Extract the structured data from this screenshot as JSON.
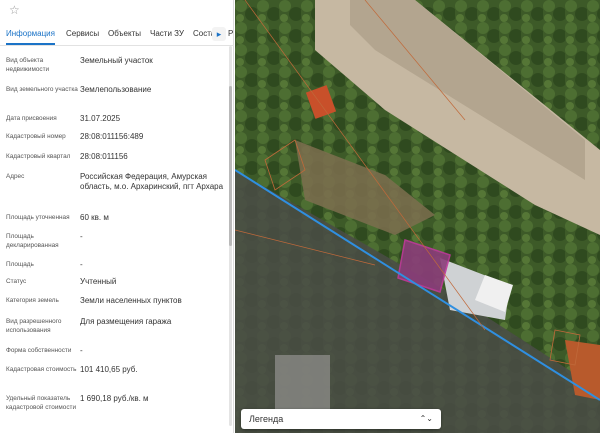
{
  "panel": {
    "star_icon": "star-icon",
    "tabs": [
      "Информация",
      "Сервисы",
      "Объекты",
      "Части ЗУ",
      "Соста"
    ],
    "tab_more": "Р",
    "rows": [
      {
        "label": "Вид объекта недвижимости",
        "value": "Земельный участок"
      },
      {
        "label": "Вид земельного участка",
        "value": "Землепользование"
      },
      {
        "label": "Дата присвоения",
        "value": "31.07.2025"
      },
      {
        "label": "Кадастровый номер",
        "value": "28:08:011156:489"
      },
      {
        "label": "Кадастровый квартал",
        "value": "28:08:011156"
      },
      {
        "label": "Адрес",
        "value": "Российская Федерация, Амурская область, м.о. Архаринский, пгт Архара"
      },
      {
        "label": "Площадь уточненная",
        "value": "60 кв. м"
      },
      {
        "label": "Площадь декларированная",
        "value": "-"
      },
      {
        "label": "Площадь",
        "value": "-"
      },
      {
        "label": "Статус",
        "value": "Учтенный"
      },
      {
        "label": "Категория земель",
        "value": "Земли населенных пунктов"
      },
      {
        "label": "Вид разрешенного использования",
        "value": "Для размещения гаража"
      },
      {
        "label": "Форма собственности",
        "value": "-"
      },
      {
        "label": "Кадастровая стоимость",
        "value": "101 410,65 руб."
      },
      {
        "label": "Удельный показатель кадастровой стоимости",
        "value": "1 690,18 руб./кв. м"
      }
    ]
  },
  "map": {
    "legend_label": "Легенда",
    "legend_icon": "chevron-up-down-icon",
    "parcel_color": "#c0399b",
    "boundary_color": "#2f8fe0"
  }
}
